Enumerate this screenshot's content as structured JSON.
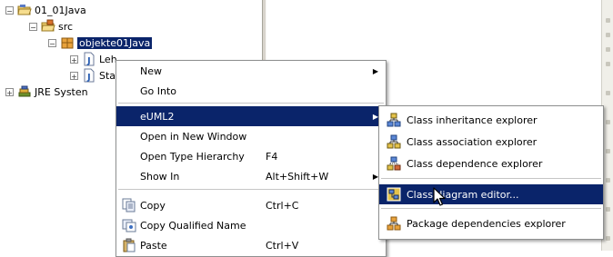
{
  "tree": {
    "items": [
      {
        "label": "01_01Java"
      },
      {
        "label": "src"
      },
      {
        "label": "objekte01Java"
      },
      {
        "label": "Leh"
      },
      {
        "label": "Sta"
      },
      {
        "label": "JRE Systen"
      }
    ]
  },
  "context_menu": {
    "items": [
      {
        "label": "New",
        "has_submenu": true
      },
      {
        "label": "Go Into"
      },
      {
        "label": "eUML2",
        "has_submenu": true,
        "highlighted": true
      },
      {
        "label": "Open in New Window"
      },
      {
        "label": "Open Type Hierarchy",
        "accel": "F4"
      },
      {
        "label": "Show In",
        "accel": "Alt+Shift+W",
        "has_submenu": true
      },
      {
        "label": "Copy",
        "accel": "Ctrl+C"
      },
      {
        "label": "Copy Qualified Name"
      },
      {
        "label": "Paste",
        "accel": "Ctrl+V"
      }
    ]
  },
  "submenu": {
    "items": [
      {
        "label": "Class inheritance explorer"
      },
      {
        "label": "Class association explorer"
      },
      {
        "label": "Class dependence explorer"
      },
      {
        "label": "Class diagram editor...",
        "highlighted": true
      },
      {
        "label": "Package dependencies explorer"
      }
    ]
  },
  "colors": {
    "selection": "#0a246a",
    "menu_bg": "#ffffff",
    "separator": "#c6c6c6"
  }
}
